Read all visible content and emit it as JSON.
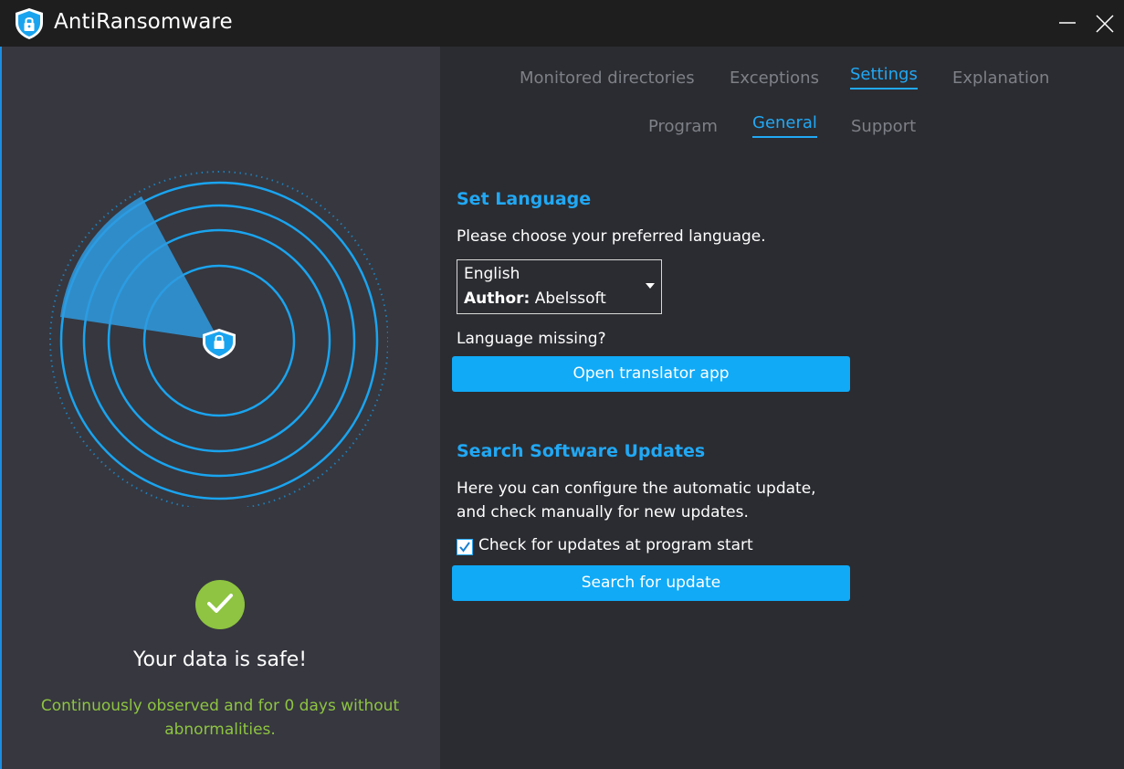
{
  "app": {
    "title": "AntiRansomware",
    "icon": "shield-lock-icon"
  },
  "window_controls": {
    "minimize_icon": "minimize-icon",
    "close_icon": "close-icon"
  },
  "status": {
    "icon": "checkmark-circle-icon",
    "title": "Your data is safe!",
    "description": "Continuously observed and for 0 days without abnormalities."
  },
  "tabs": {
    "main": [
      {
        "label": "Monitored directories",
        "active": false
      },
      {
        "label": "Exceptions",
        "active": false
      },
      {
        "label": "Settings",
        "active": true
      },
      {
        "label": "Explanation",
        "active": false
      }
    ],
    "sub": [
      {
        "label": "Program",
        "active": false
      },
      {
        "label": "General",
        "active": true
      },
      {
        "label": "Support",
        "active": false
      }
    ]
  },
  "language": {
    "title": "Set Language",
    "prompt": "Please choose your preferred language.",
    "selected": "English",
    "author_label": "Author:",
    "author": "Abelssoft",
    "missing": "Language missing?",
    "translator_button": "Open translator app"
  },
  "updates": {
    "title": "Search Software Updates",
    "description_line1": "Here you can configure the automatic update,",
    "description_line2": "and check manually for new updates.",
    "check_label": "Check for updates at program start",
    "checked": true,
    "search_button": "Search for update"
  },
  "colors": {
    "accent": "#21a8f4",
    "button": "#10aaf7",
    "success": "#8ec441",
    "left_panel": "#36373f",
    "right_panel": "#2b2c31",
    "titlebar": "#1e1e1f"
  }
}
